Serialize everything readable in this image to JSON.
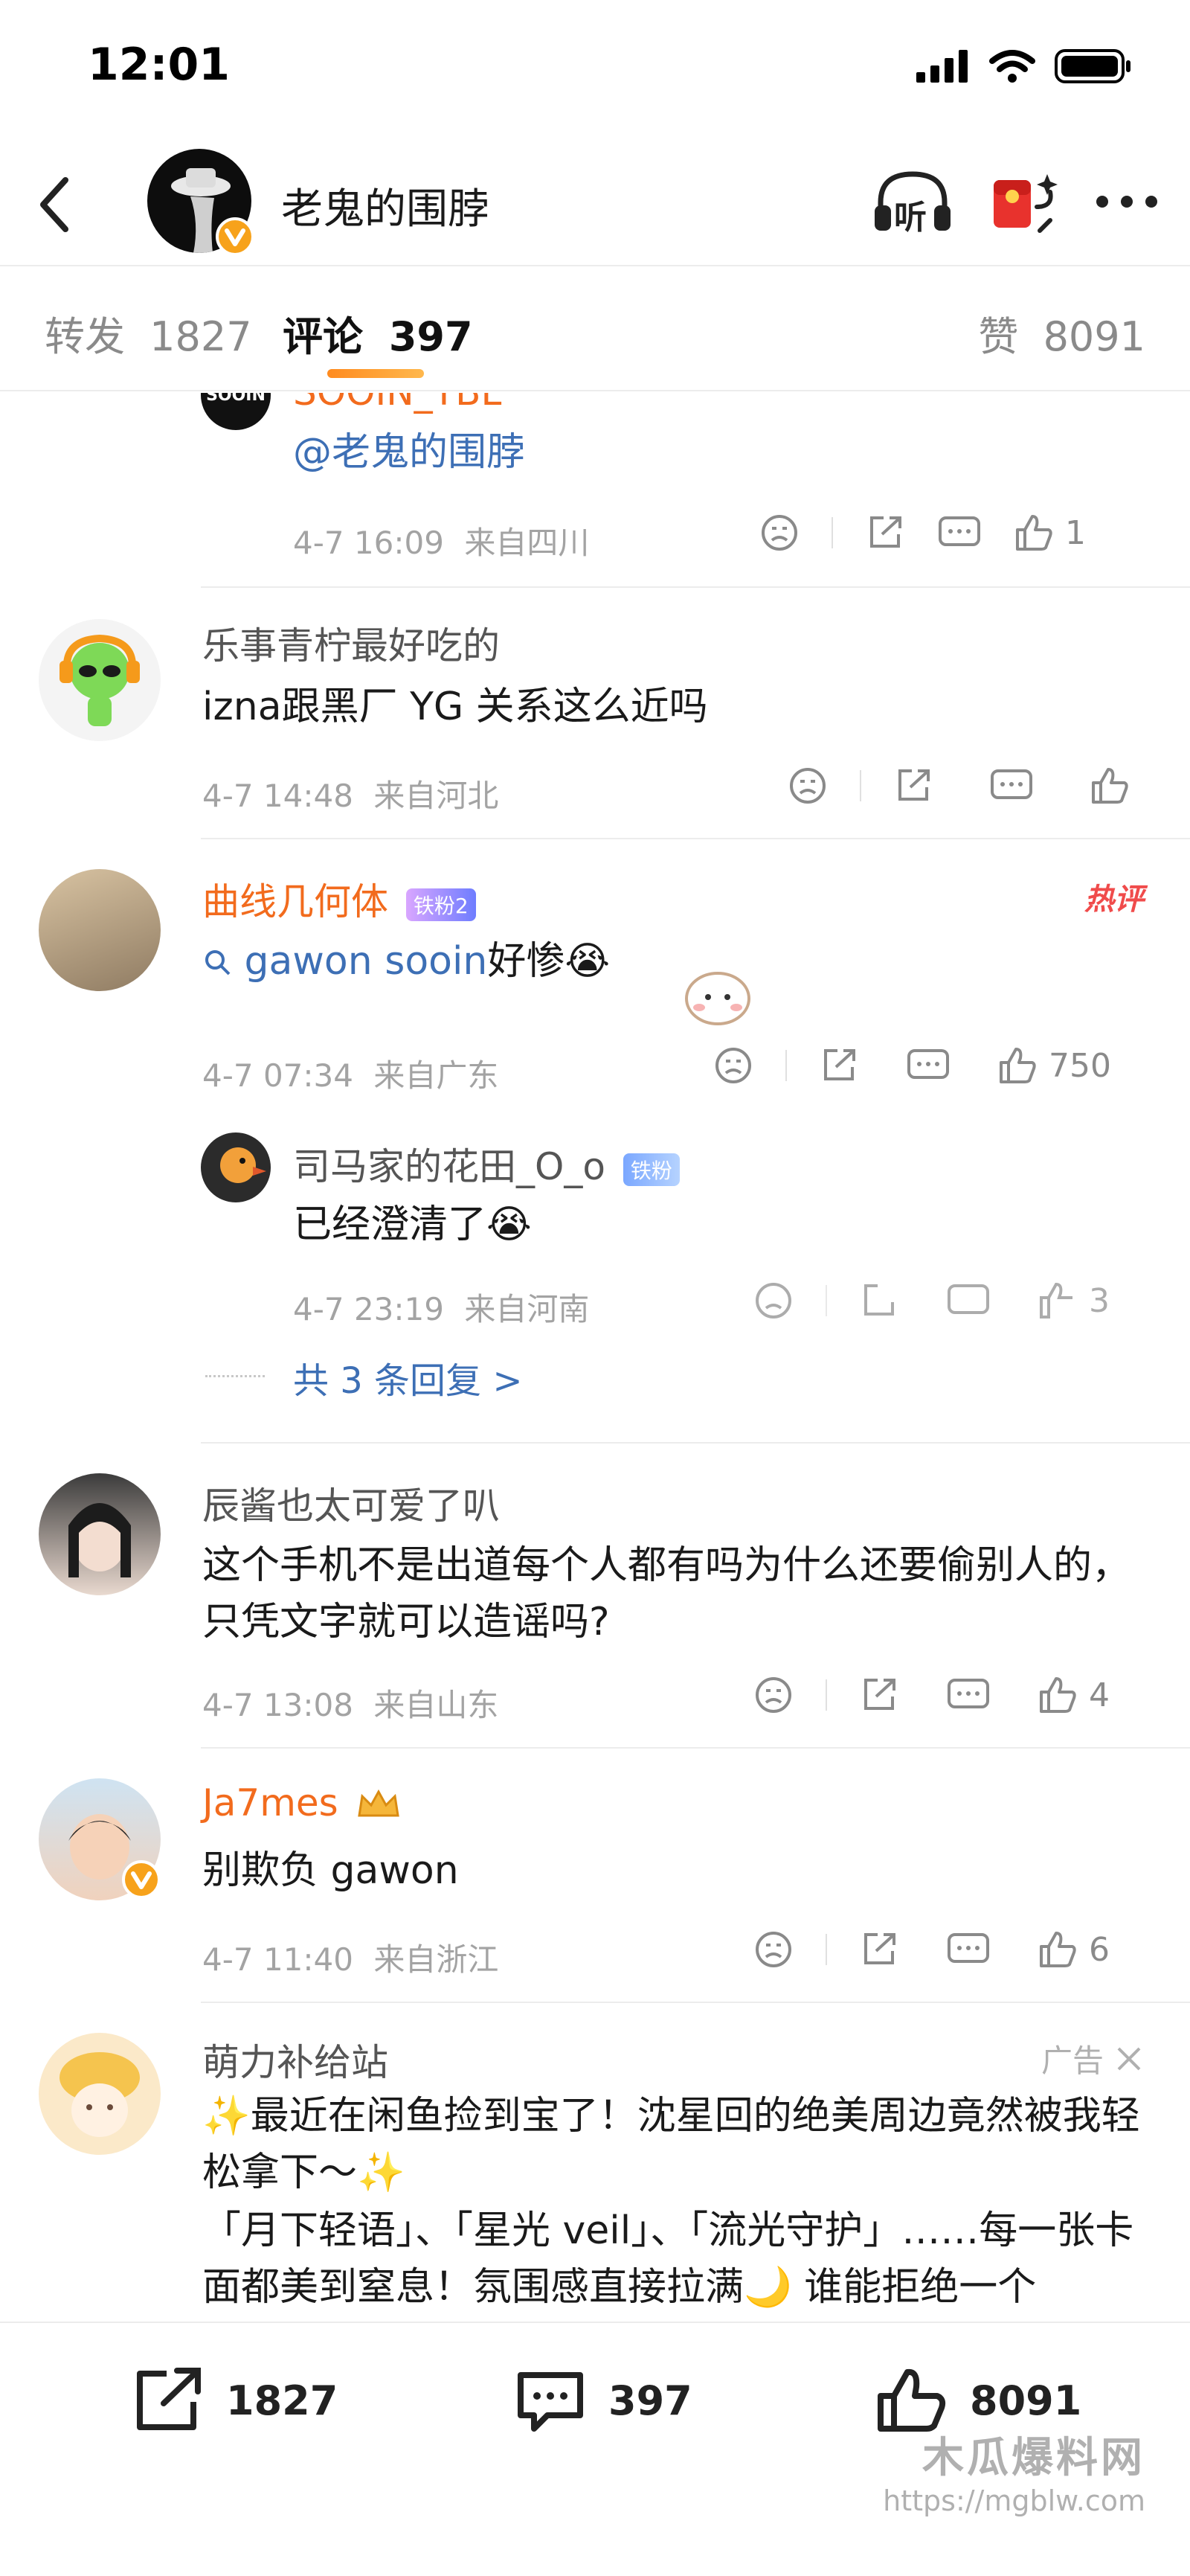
{
  "status_bar": {
    "time": "12:01"
  },
  "header": {
    "title": "老鬼的围脖",
    "listen_label": "听"
  },
  "tabs": {
    "repost_label": "转发",
    "repost_count": "1827",
    "comments_label": "评论",
    "comments_count": "397",
    "likes_label": "赞",
    "likes_count": "8091"
  },
  "comments": [
    {
      "user": "SOOIN_TBL",
      "avatar_text": "SOOIN",
      "text": "@老鬼的围脖",
      "time": "4-7 16:09",
      "location": "来自四川",
      "likes": "1"
    },
    {
      "user": "乐事青柠最好吃的",
      "text": "izna跟黑厂 YG 关系这么近吗",
      "time": "4-7 14:48",
      "location": "来自河北",
      "likes": ""
    },
    {
      "user": "曲线几何体",
      "badge": "铁粉2",
      "hot_label": "热评",
      "search_term": "gawon sooin",
      "text_suffix": "好惨😭",
      "time": "4-7 07:34",
      "location": "来自广东",
      "likes": "750",
      "reply": {
        "user": "司马家的花田_O_o",
        "badge": "铁粉",
        "text": "已经澄清了😭",
        "time": "4-7 23:19",
        "location": "来自河南",
        "likes": "3"
      },
      "more_replies": "共 3 条回复 >"
    },
    {
      "user": "辰酱也太可爱了叭",
      "text": "这个手机不是出道每个人都有吗为什么还要偷别人的，只凭文字就可以造谣吗?",
      "time": "4-7 13:08",
      "location": "来自山东",
      "likes": "4"
    },
    {
      "user": "Ja7mes",
      "text": "别欺负 gawon",
      "time": "4-7 11:40",
      "location": "来自浙江",
      "likes": "6"
    },
    {
      "user": "萌力补给站",
      "ad_label": "广告",
      "text_line1": "✨最近在闲鱼捡到宝了！沈星回的绝美周边竟然被我轻松拿下～✨",
      "text_line2": "「月下轻语」、「星光 veil」、「流光守护」……每一张卡面都美到窒息！氛围感直接拉满🌙 谁能拒绝一个"
    }
  ],
  "bottom_bar": {
    "reposts": "1827",
    "comments": "397",
    "likes": "8091"
  },
  "watermark": {
    "line1": "木瓜爆料网",
    "line2": "https://mgblw.com"
  },
  "colors": {
    "accent": "#f26b1d",
    "hot": "#f04b4b",
    "link": "#3d6fb5"
  }
}
